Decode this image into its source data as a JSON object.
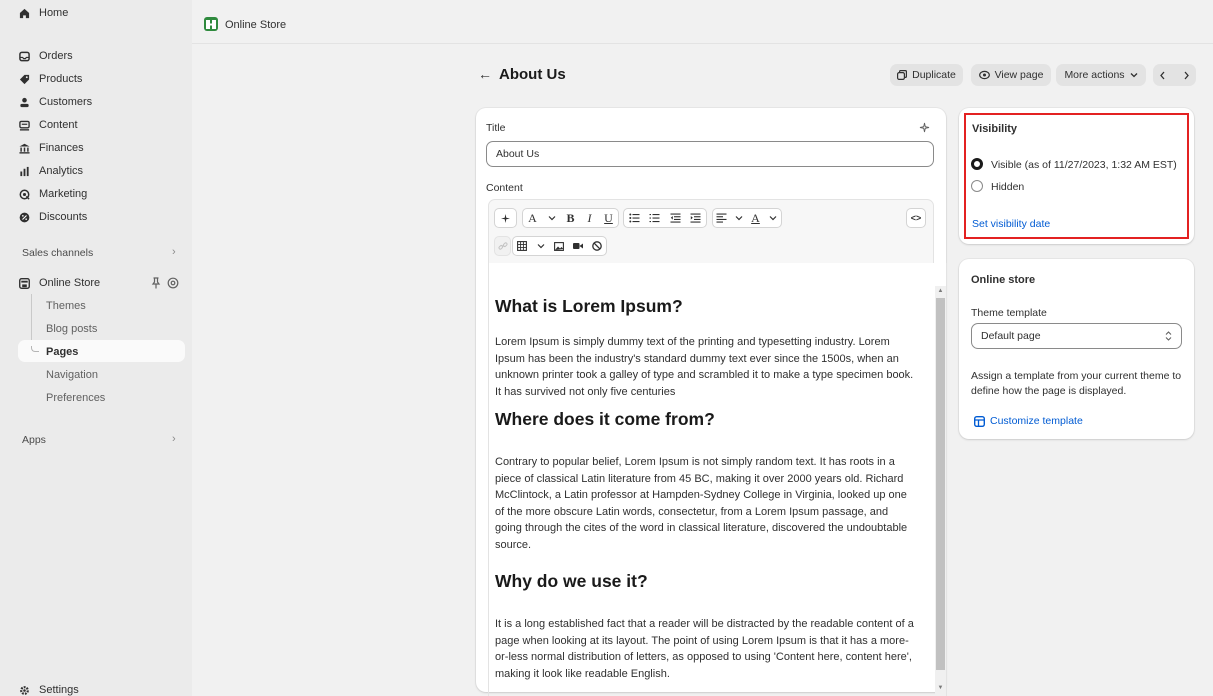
{
  "sidebar": {
    "items": [
      {
        "label": "Home",
        "icon": "home-icon"
      },
      {
        "label": "Orders",
        "icon": "inbox-icon"
      },
      {
        "label": "Products",
        "icon": "tag-icon"
      },
      {
        "label": "Customers",
        "icon": "person-icon"
      },
      {
        "label": "Content",
        "icon": "content-icon"
      },
      {
        "label": "Finances",
        "icon": "bank-icon"
      },
      {
        "label": "Analytics",
        "icon": "bar-chart-icon"
      },
      {
        "label": "Marketing",
        "icon": "target-icon"
      },
      {
        "label": "Discounts",
        "icon": "discount-icon"
      }
    ],
    "sales_channels_label": "Sales channels",
    "online_store_label": "Online Store",
    "sub_items": [
      "Themes",
      "Blog posts",
      "Pages",
      "Navigation",
      "Preferences"
    ],
    "apps_label": "Apps",
    "settings_label": "Settings"
  },
  "topbar": {
    "title": "Online Store"
  },
  "page": {
    "back_arrow": "←",
    "title": "About Us",
    "duplicate_label": "Duplicate",
    "view_page_label": "View page",
    "more_actions_label": "More actions"
  },
  "editor": {
    "title_label": "Title",
    "title_value": "About Us",
    "content_label": "Content",
    "toolbar": {
      "font": "A",
      "bold": "B",
      "italic": "I",
      "underline": "U",
      "text_color": "A",
      "code": "<>"
    },
    "sections": [
      {
        "heading": "What is Lorem Ipsum?",
        "paragraph": "Lorem Ipsum  is simply dummy text of the printing and typesetting industry. Lorem Ipsum has been the industry's standard dummy text ever since the 1500s, when an unknown printer took a galley of type and scrambled it to make a type specimen book. It has survived not only five centuries"
      },
      {
        "heading": "Where does it come from?",
        "paragraph": "Contrary to popular belief, Lorem Ipsum is not simply random text. It has roots in a piece of classical Latin literature from 45 BC, making it over 2000 years old. Richard McClintock, a Latin professor at Hampden-Sydney College in Virginia, looked up one of the more obscure Latin words, consectetur, from a Lorem Ipsum passage, and going through the cites of the word in classical literature, discovered the undoubtable source."
      },
      {
        "heading": "Why do we use it?",
        "paragraph": "It is a long established fact that a reader will be distracted by the readable content of a page when looking at its layout. The point of using Lorem Ipsum is that it has a more-or-less normal distribution of letters, as opposed to using 'Content here, content here', making it look like readable English."
      }
    ]
  },
  "visibility": {
    "title": "Visibility",
    "visible_label": "Visible (as of 11/27/2023, 1:32 AM EST)",
    "hidden_label": "Hidden",
    "selected": "visible",
    "set_date_link": "Set visibility date",
    "highlight_color": "#e32121"
  },
  "online_store": {
    "title": "Online store",
    "theme_template_label": "Theme template",
    "theme_template_value": "Default page",
    "help_text": "Assign a template from your current theme to define how the page is displayed.",
    "customize_link": "Customize template"
  },
  "colors": {
    "link": "#005bd3",
    "brand_green": "#2f8a3e"
  }
}
